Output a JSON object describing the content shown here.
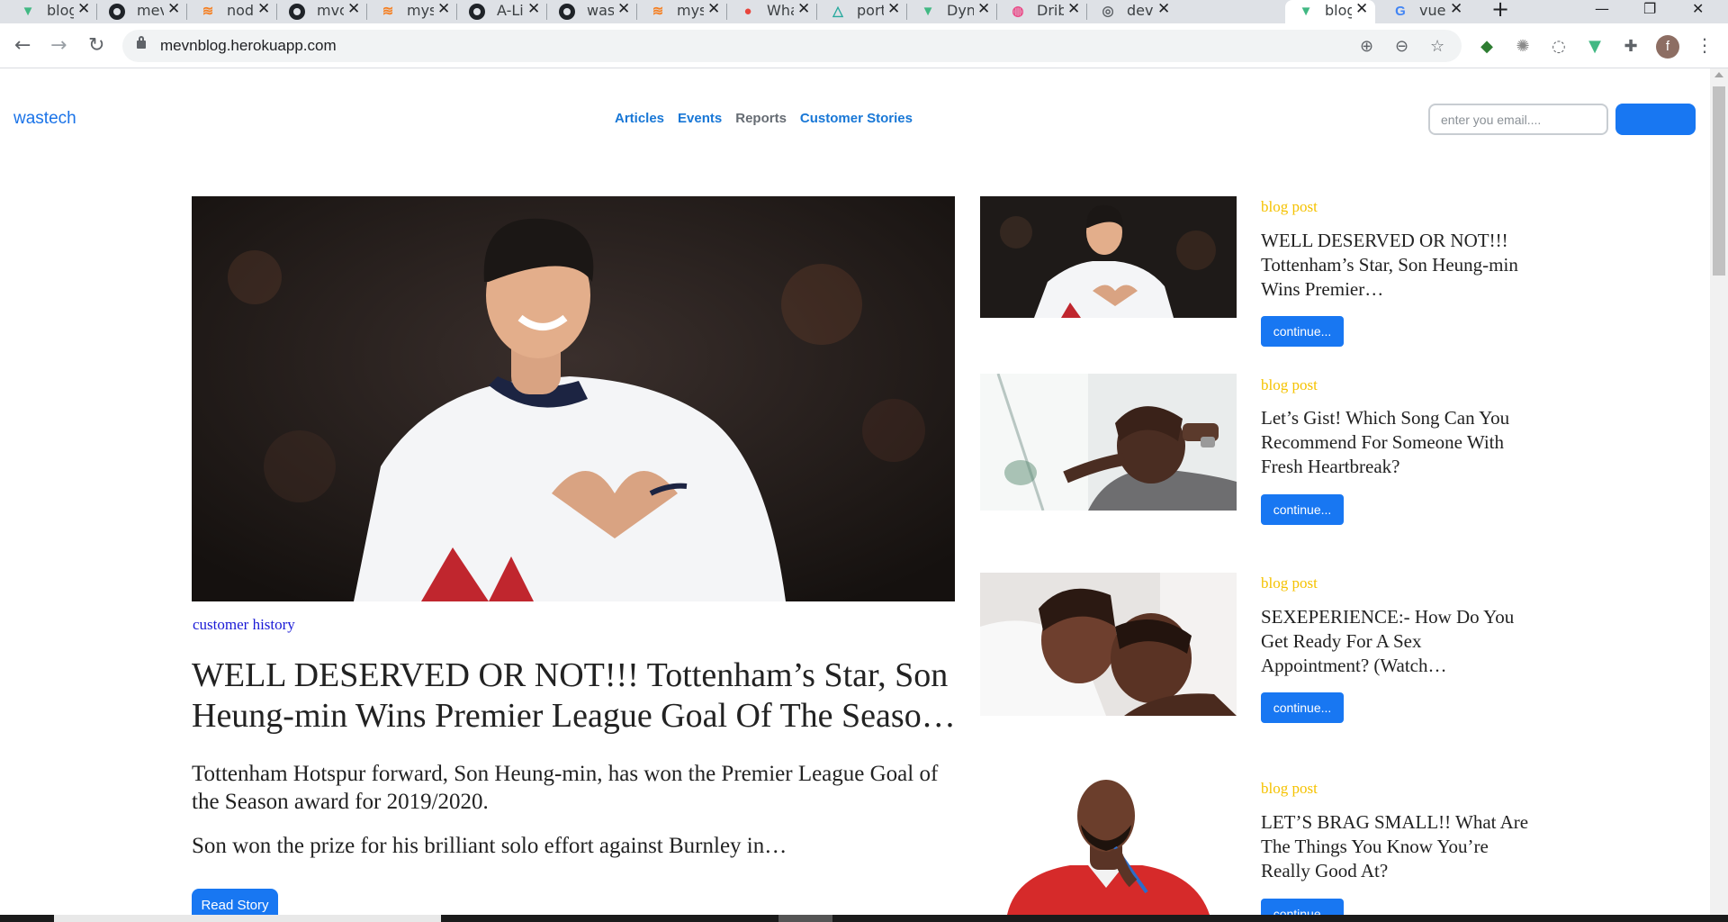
{
  "browser": {
    "tabs": [
      {
        "title": "blog",
        "icon": "vue-icon",
        "color": "#41b883"
      },
      {
        "title": "mevn",
        "icon": "github-icon",
        "color": "#1f2328"
      },
      {
        "title": "node",
        "icon": "stackoverflow-icon",
        "color": "#f48024"
      },
      {
        "title": "mvc",
        "icon": "github-icon",
        "color": "#1f2328"
      },
      {
        "title": "mysql",
        "icon": "stackoverflow-icon",
        "color": "#f48024"
      },
      {
        "title": "A-Li",
        "icon": "github-icon",
        "color": "#1f2328"
      },
      {
        "title": "wast",
        "icon": "github-icon",
        "color": "#1f2328"
      },
      {
        "title": "mysql",
        "icon": "stackoverflow-icon",
        "color": "#f48024"
      },
      {
        "title": "What",
        "icon": "alert-icon",
        "color": "#e8453c"
      },
      {
        "title": "port",
        "icon": "triangle-icon",
        "color": "#28a99e"
      },
      {
        "title": "Dyna",
        "icon": "vue-icon",
        "color": "#41b883"
      },
      {
        "title": "Dribbble",
        "icon": "dribbble-icon",
        "color": "#ea4c89"
      },
      {
        "title": "deve",
        "icon": "globe-icon",
        "color": "#5f6368"
      },
      {
        "title": "blog",
        "icon": "vue-icon",
        "color": "#41b883",
        "active": true
      },
      {
        "title": "vue",
        "icon": "google-icon",
        "color": "#4285f4"
      }
    ],
    "url": "mevnblog.herokuapp.com"
  },
  "site": {
    "brand": "wastech",
    "nav": [
      "Articles",
      "Events",
      "Reports",
      "Customer Stories"
    ],
    "email_placeholder": "enter you email....",
    "subscribe_label": ""
  },
  "hero": {
    "category": "customer history",
    "title": "WELL DESERVED OR NOT!!! Tottenham’s Star, Son Heung-min Wins Premier League Goal Of The Seaso…",
    "paragraph1": "Tottenham Hotspur forward, Son Heung-min, has won the Premier League Goal of the Season award for 2019/2020.",
    "paragraph2": "Son won the prize for his brilliant solo effort against Burnley in…",
    "button": "Read Story"
  },
  "cards": [
    {
      "category": "blog post",
      "title": "WELL DESERVED OR NOT!!! Tottenham’s Star, Son Heung-min Wins Premier…",
      "button": "continue..."
    },
    {
      "category": "blog post",
      "title": "Let’s Gist! Which Song Can You Recommend For Someone With Fresh Heartbreak?",
      "button": "continue..."
    },
    {
      "category": "blog post",
      "title": "SEXEPERIENCE:- How Do You Get Ready For A Sex Appointment? (Watch…",
      "button": "continue..."
    },
    {
      "category": "blog post",
      "title": "LET’S BRAG SMALL!! What Are The Things You Know You’re Really Good At?",
      "button": "continue..."
    }
  ],
  "colors": {
    "accent": "#1877f2",
    "category_yellow": "#f5c200",
    "category_blue": "#1a1ad6",
    "brand_blue": "#1a73e8"
  },
  "profile_initial": "f"
}
